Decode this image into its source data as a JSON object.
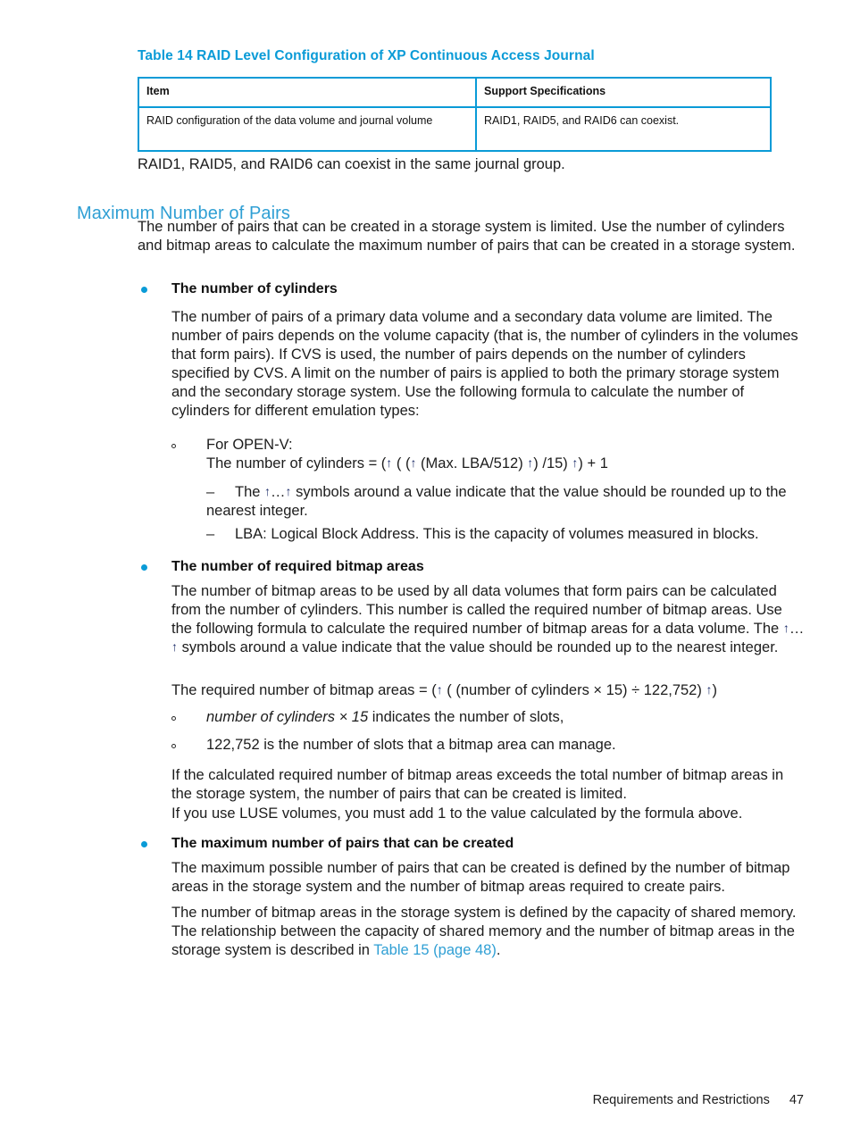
{
  "document": {
    "table": {
      "caption": "Table 14 RAID Level Configuration of XP Continuous Access Journal",
      "headers": [
        "Item",
        "Support Specifications"
      ],
      "rows": [
        [
          "RAID configuration of the data volume and journal volume",
          "RAID1, RAID5, and RAID6 can coexist."
        ]
      ]
    },
    "intro_line": "RAID1, RAID5, and RAID6 can coexist in the same journal group.",
    "section": {
      "heading": "Maximum Number of Pairs",
      "lead_paragraph": "The number of pairs that can be created in a storage system is limited. Use the number of cylinders and bitmap areas to calculate the maximum number of pairs that can be created in a storage system."
    },
    "bullets": {
      "cylinders": {
        "title": "The number of cylinders",
        "body": "The number of pairs of a primary data volume and a secondary data volume are limited. The number of pairs depends on the volume capacity (that is, the number of cylinders in the volumes that form pairs). If CVS is used, the number of pairs depends on the number of cylinders specified by CVS. A limit on the number of pairs is applied to both the primary storage system and the secondary storage system. Use the following formula to calculate the number of cylinders for different emulation types:",
        "sub_openv_label": "For OPEN-V:",
        "formula_prefix": "The number of cylinders = (",
        "formula_part1": " ( (",
        "formula_part2": " (Max. LBA/512) ",
        "formula_part3": ") /15) ",
        "formula_suffix": ") + 1",
        "note_rounding_pre": "The ",
        "note_rounding_mid": "…",
        "note_rounding_post": " symbols around a value indicate that the value should be rounded up to the nearest integer.",
        "note_lba": "LBA: Logical Block Address. This is the capacity of volumes measured in blocks."
      },
      "bitmap": {
        "title": "The number of required bitmap areas",
        "body_part1": "The number of bitmap areas to be used by all data volumes that form pairs can be calculated from the number of cylinders. This number is called the required number of bitmap areas. Use the following formula to calculate the required number of bitmap areas for a data volume. The ",
        "body_mid": "…",
        "body_part2": " symbols around a value indicate that the value should be rounded up to the nearest integer.",
        "formula_prefix": "The required number of bitmap areas = (",
        "formula_body": " ( (number of cylinders × 15) ÷ 122,752) ",
        "formula_suffix": ")",
        "sub_slots_italic": "number of cylinders × 15",
        "sub_slots_rest": " indicates the number of slots,",
        "sub_capacity": "122,752 is the number of slots that a bitmap area can manage.",
        "note_exceeds": "If the calculated required number of bitmap areas exceeds the total number of bitmap areas in the storage system, the number of pairs that can be created is limited.",
        "note_luse": "If you use LUSE volumes, you must add 1 to the value calculated by the formula above."
      },
      "maximum": {
        "title": "The maximum number of pairs that can be created",
        "body1": "The maximum possible number of pairs that can be created is defined by the number of bitmap areas in the storage system and the number of bitmap areas required to create pairs.",
        "body2_pre": "The number of bitmap areas in the storage system is defined by the capacity of shared memory. The relationship between the capacity of shared memory and the number of bitmap areas in the storage system is described in ",
        "body2_link": "Table 15 (page 48)",
        "body2_post": "."
      }
    },
    "footer": {
      "chapter": "Requirements and Restrictions",
      "page_number": "47"
    },
    "symbols": {
      "ceiling_arrow": "↑",
      "dash_marker": "–"
    },
    "colors": {
      "table_caption": "#0a9bd7",
      "table_border": "#0a9bd7",
      "heading": "#2f9fd4",
      "bullet": "#0a9bd7",
      "link": "#2f9fd4",
      "arrow_symbol": "#1f2f6b",
      "body_text": "#1c1c1c"
    }
  }
}
